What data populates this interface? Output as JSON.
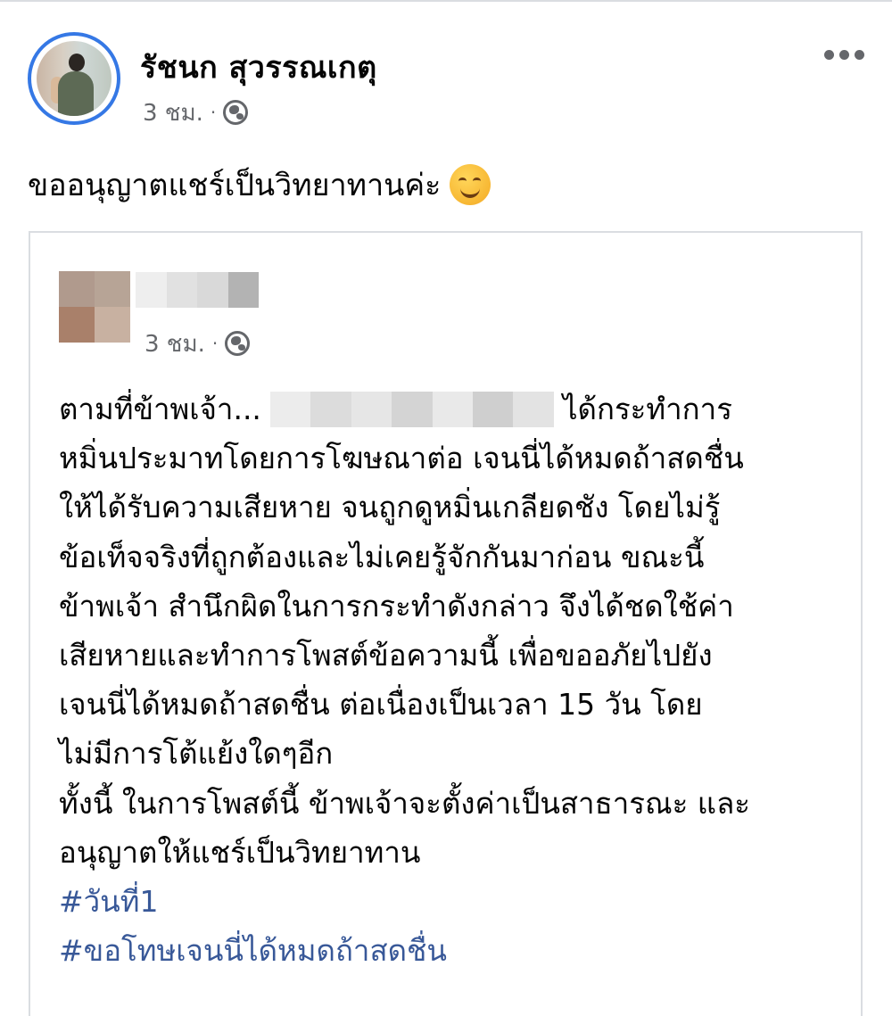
{
  "post": {
    "author": "รัชนก สุวรรณเกตุ",
    "time": "3 ชม.",
    "separator": "·",
    "audience_icon": "globe-icon",
    "text": "ขออนุญาตแชร์เป็นวิทยาทานค่ะ",
    "emoji": "smiling-face-emoji",
    "menu_icon": "more-options-icon"
  },
  "shared": {
    "time": "3 ชม.",
    "separator": "·",
    "audience_icon": "globe-icon",
    "line1_start": "ตามที่ข้าพเจ้า...",
    "line1_end": "ได้กระทำการ",
    "lines": [
      "หมิ่นประมาทโดยการโฆษณาต่อ เจนนี่ได้หมดถ้าสดชื่น",
      "ให้ได้รับความเสียหาย จนถูกดูหมิ่นเกลียดชัง โดยไม่รู้",
      "ข้อเท็จจริงที่ถูกต้องและไม่เคยรู้จักกันมาก่อน ขณะนี้",
      "ข้าพเจ้า สำนึกผิดในการกระทำดังกล่าว จึงได้ชดใช้ค่า",
      "เสียหายและทำการโพสต์ข้อความนี้ เพื่อขออภัยไปยัง",
      "เจนนี่ได้หมดถ้าสดชื่น ต่อเนื่องเป็นเวลา 15 วัน โดย",
      "ไม่มีการโต้แย้งใดๆอีก",
      "ทั้งนี้ ในการโพสต์นี้ ข้าพเจ้าจะตั้งค่าเป็นสาธารณะ และ",
      "อนุญาตให้แชร์เป็นวิทยาทาน"
    ],
    "hashtags": [
      "#วันที่1",
      "#ขอโทษเจนนี่ได้หมดถ้าสดชื่น"
    ]
  },
  "colors": {
    "avatar_ring": "#3578e5",
    "hashtag": "#385898",
    "meta_text": "#65676b",
    "card_border": "#dadde1"
  }
}
